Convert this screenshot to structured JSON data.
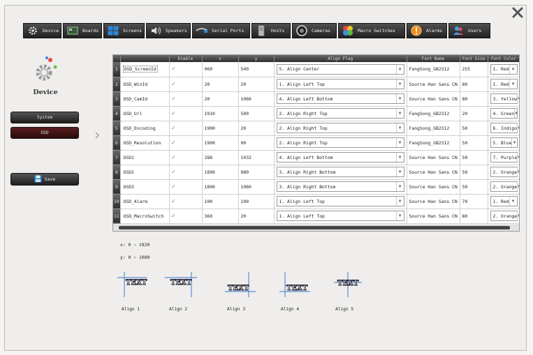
{
  "tabs": [
    {
      "label": "Device",
      "icon": "gear-icon"
    },
    {
      "label": "Boards",
      "icon": "board-icon"
    },
    {
      "label": "Screens",
      "icon": "screen-icon"
    },
    {
      "label": "Speakers",
      "icon": "speaker-icon"
    },
    {
      "label": "Serial Ports",
      "icon": "cable-icon"
    },
    {
      "label": "Hosts",
      "icon": "server-icon"
    },
    {
      "label": "Cameras",
      "icon": "camera-icon"
    },
    {
      "label": "Macro Switches",
      "icon": "macro-icon"
    },
    {
      "label": "Alarms",
      "icon": "alarm-icon"
    },
    {
      "label": "Users",
      "icon": "users-icon"
    }
  ],
  "sidebar": {
    "title": "Device",
    "system_label": "System",
    "osd_label": "OSD",
    "save_label": "Save"
  },
  "table": {
    "headers": [
      "Enable",
      "x",
      "y",
      "Align Flag",
      "Font Name",
      "Font Size",
      "Font Color"
    ],
    "rows": [
      {
        "num": "1",
        "name": "OSD_ScreenId",
        "x": "960",
        "y": "540",
        "align": "5. Align Center",
        "font": "FangSong_GB2312",
        "size": "255",
        "color": "1. Red"
      },
      {
        "num": "2",
        "name": "OSD_WinId",
        "x": "20",
        "y": "20",
        "align": "1. Align Left Top",
        "font": "Source Han Sans CN",
        "size": "80",
        "color": "1. Red"
      },
      {
        "num": "3",
        "name": "OSD_CamId",
        "x": "20",
        "y": "1060",
        "align": "4. Align Left Bottom",
        "font": "Source Han Sans CN",
        "size": "80",
        "color": "3. Yellow"
      },
      {
        "num": "4",
        "name": "OSD_Url",
        "x": "1910",
        "y": "500",
        "align": "2. Align Right Top",
        "font": "FangSong_GB2312",
        "size": "20",
        "color": "4. Green"
      },
      {
        "num": "5",
        "name": "OSD_Encoding",
        "x": "1900",
        "y": "20",
        "align": "2. Align Right Top",
        "font": "FangSong_GB2312",
        "size": "50",
        "color": "6. Indigo"
      },
      {
        "num": "6",
        "name": "OSD_Resolution",
        "x": "1900",
        "y": "90",
        "align": "2. Align Right Top",
        "font": "FangSong_GB2312",
        "size": "50",
        "color": "5. Blue"
      },
      {
        "num": "7",
        "name": "OSD1",
        "x": "288",
        "y": "1032",
        "align": "4. Align Left Bottom",
        "font": "Source Han Sans CN",
        "size": "50",
        "color": "7. Purple"
      },
      {
        "num": "8",
        "name": "OSD2",
        "x": "1890",
        "y": "980",
        "align": "3. Align Right Bottom",
        "font": "Source Han Sans CN",
        "size": "50",
        "color": "2. Orange"
      },
      {
        "num": "9",
        "name": "OSD3",
        "x": "1890",
        "y": "1060",
        "align": "3. Align Right Bottom",
        "font": "Source Han Sans CN",
        "size": "50",
        "color": "2. Orange"
      },
      {
        "num": "10",
        "name": "OSD_Alarm",
        "x": "100",
        "y": "100",
        "align": "1. Align Left Top",
        "font": "Source Han Sans CN",
        "size": "70",
        "color": "1. Red"
      },
      {
        "num": "11",
        "name": "OSD_MacroSwitch",
        "x": "360",
        "y": "20",
        "align": "1. Align Left Top",
        "font": "Source Han Sans CN",
        "size": "80",
        "color": "2. Orange"
      }
    ]
  },
  "ranges": {
    "x": "x: 0 ~ 1920",
    "y": "y: 0 ~ 1080"
  },
  "align_examples": {
    "sample_text": "TEXT",
    "captions": [
      "Align 1",
      "Align 2",
      "Align 3",
      "Align 4",
      "Align 5"
    ]
  }
}
